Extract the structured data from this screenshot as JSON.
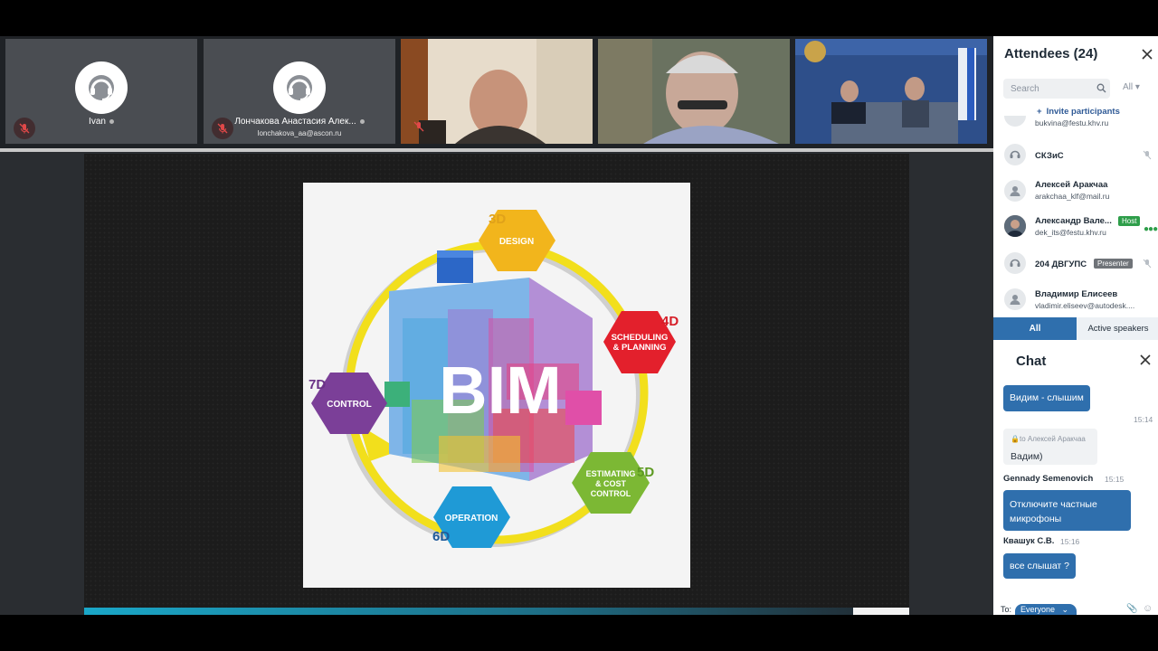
{
  "tiles": [
    {
      "name": "Ivan",
      "email": "",
      "type": "avatar"
    },
    {
      "name": "Лончакова Анастасия Алек...",
      "email": "lonchakova_aa@ascon.ru",
      "type": "avatar"
    },
    {
      "name": "",
      "email": "",
      "type": "video"
    },
    {
      "name": "",
      "email": "",
      "type": "video"
    },
    {
      "name": "",
      "email": "",
      "type": "video"
    }
  ],
  "slide": {
    "center_label": "BIM",
    "segments": [
      {
        "dim": "3D",
        "label_lines": [
          "DESIGN"
        ],
        "color": "#f2b51c",
        "dim_color": "#e0a21a"
      },
      {
        "dim": "4D",
        "label_lines": [
          "SCHEDULING",
          "& PLANNING"
        ],
        "color": "#e3202c",
        "dim_color": "#d61e28"
      },
      {
        "dim": "5D",
        "label_lines": [
          "ESTIMATING",
          "& COST",
          "CONTROL"
        ],
        "color": "#7cb834",
        "dim_color": "#5d9a22"
      },
      {
        "dim": "6D",
        "label_lines": [
          "OPERATION"
        ],
        "color": "#1f9ad6",
        "dim_color": "#1f5a9a"
      },
      {
        "dim": "7D",
        "label_lines": [
          "CONTROL"
        ],
        "color": "#7b3f98",
        "dim_color": "#6a3286"
      }
    ]
  },
  "attendees": {
    "title": "Attendees (24)",
    "search_placeholder": "Search",
    "filter_label": "All",
    "invite_label": "Invite participants",
    "items": [
      {
        "name": "",
        "email": "bukvina@festu.khv.ru",
        "badge": ""
      },
      {
        "name": "СКЗиС",
        "email": "",
        "badge": ""
      },
      {
        "name": "Алексей Аракчаа",
        "email": "arakchaa_klf@mail.ru",
        "badge": ""
      },
      {
        "name": "Александр Вале...",
        "email": "dek_its@festu.khv.ru",
        "badge": "Host"
      },
      {
        "name": "204 ДВГУПС",
        "email": "",
        "badge": "Presenter"
      },
      {
        "name": "Владимир Елисеев",
        "email": "vladimir.eliseev@autodesk....",
        "badge": ""
      }
    ],
    "tabs": {
      "all": "All",
      "active": "Active speakers"
    }
  },
  "chat": {
    "title": "Chat",
    "messages": [
      {
        "author": "",
        "time": "",
        "text": "Видим - слышим"
      },
      {
        "author": "",
        "time": "15:14",
        "text": ""
      },
      {
        "author": "",
        "time": "",
        "private_to": "to Алексей Аракчаа",
        "text": "Вадим)"
      },
      {
        "author": "Gennady Semenovich",
        "time": "15:15",
        "text": "Отключите частные микрофоны",
        "text_lines": [
          "Отключите частные",
          "микрофоны"
        ]
      },
      {
        "author": "Квашук С.В.",
        "time": "15:16",
        "text": "все слышат ?"
      }
    ],
    "to_label": "To:",
    "to_value": "Everyone"
  },
  "colors": {
    "accent": "#2f6fad",
    "host_badge": "#2e9e4a",
    "presenter_badge": "#6f7378"
  }
}
